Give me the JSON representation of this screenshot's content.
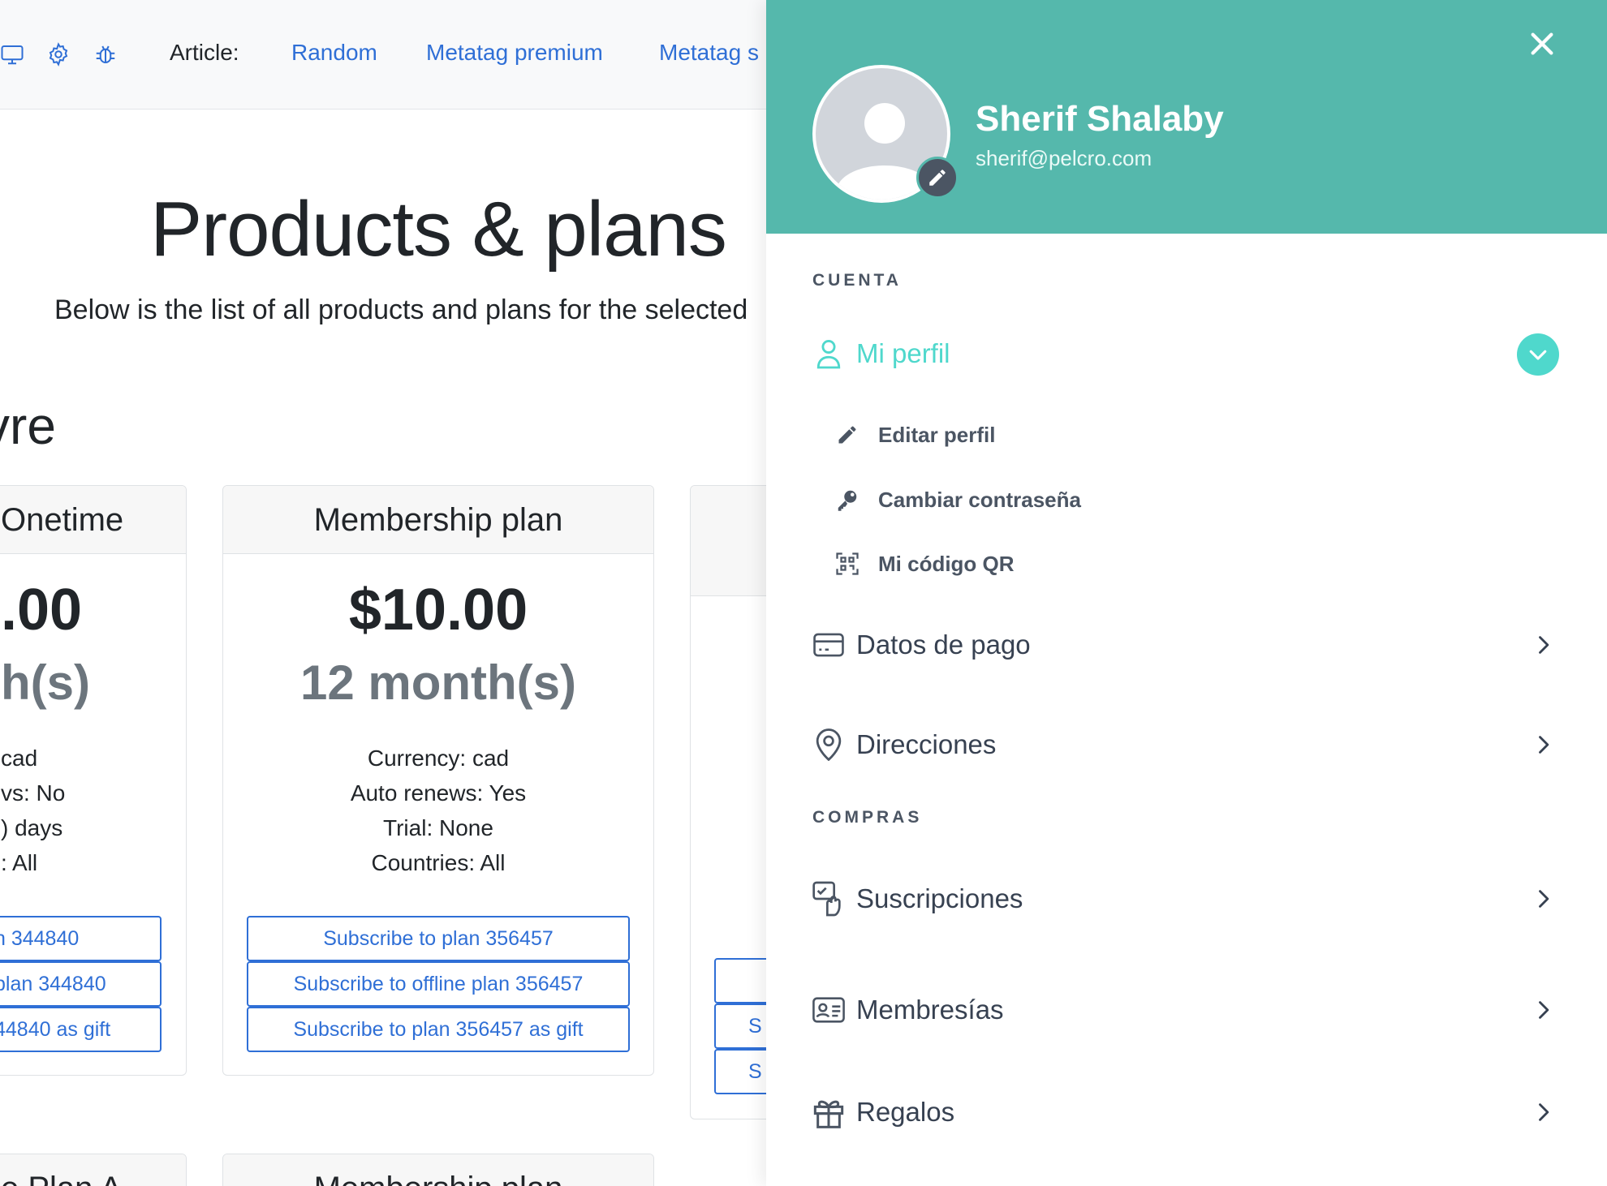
{
  "topnav": {
    "article_label": "Article:",
    "links": [
      "Random",
      "Metatag premium",
      "Metatag s"
    ],
    "icons": [
      "monitor-icon",
      "gear-icon",
      "bug-icon"
    ]
  },
  "page": {
    "title": "Products & plans",
    "subtitle": "Below is the list of all products and plans for the selected",
    "section_title": "vre"
  },
  "cards": [
    {
      "header": "Onetime",
      "price": ".00",
      "duration": "h(s)",
      "meta": [
        " cad",
        "vs: No",
        ") days",
        ": All"
      ],
      "buttons": [
        "n 344840",
        " plan 344840",
        "44840 as gift"
      ]
    },
    {
      "header": "Membership plan",
      "price": "$10.00",
      "duration": "12 month(s)",
      "meta": [
        "Currency: cad",
        "Auto renews: Yes",
        "Trial: None",
        "Countries: All"
      ],
      "buttons": [
        "Subscribe to plan 356457",
        "Subscribe to offline plan 356457",
        "Subscribe to plan 356457 as gift"
      ]
    },
    {
      "header": "",
      "buttons": [
        "",
        "S",
        "S"
      ]
    }
  ],
  "bottom_cards": [
    "e Plan A",
    "Membership plan"
  ],
  "drawer": {
    "user_name": "Sherif Shalaby",
    "user_email": "sherif@pelcro.com",
    "sections": {
      "account": "CUENTA",
      "purchases": "COMPRAS"
    },
    "profile": {
      "label": "Mi perfil",
      "items": [
        {
          "icon": "pencil-icon",
          "label": "Editar perfil"
        },
        {
          "icon": "key-icon",
          "label": "Cambiar contraseña"
        },
        {
          "icon": "qr-code-icon",
          "label": "Mi código QR"
        }
      ]
    },
    "menu": [
      {
        "icon": "credit-card-icon",
        "label": "Datos de pago"
      },
      {
        "icon": "location-pin-icon",
        "label": "Direcciones"
      },
      {
        "icon": "subscriptions-icon",
        "label": "Suscripciones"
      },
      {
        "icon": "id-card-icon",
        "label": "Membresías"
      },
      {
        "icon": "gift-icon",
        "label": "Regalos"
      }
    ],
    "accent_color": "#55b8ac",
    "active_color": "#4fd8cc"
  }
}
